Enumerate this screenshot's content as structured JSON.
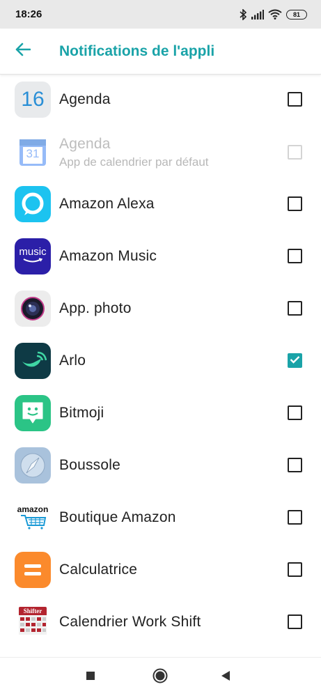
{
  "status_bar": {
    "time": "18:26",
    "battery": "81",
    "icons": [
      "bluetooth-icon",
      "signal-icon",
      "wifi-icon",
      "battery-icon"
    ]
  },
  "app_bar": {
    "title": "Notifications de l'appli",
    "back_icon": "arrow-left-icon"
  },
  "colors": {
    "accent": "#1aa3a8",
    "status_bar_bg": "#e9e9e9"
  },
  "apps": [
    {
      "name": "Agenda",
      "subtitle": "",
      "checked": false,
      "disabled": false,
      "icon_text": "16",
      "icon": "calendar-icon"
    },
    {
      "name": "Agenda",
      "subtitle": "App de calendrier par défaut",
      "checked": false,
      "disabled": true,
      "icon_text": "31",
      "icon": "google-calendar-icon"
    },
    {
      "name": "Amazon Alexa",
      "subtitle": "",
      "checked": false,
      "disabled": false,
      "icon": "alexa-icon"
    },
    {
      "name": "Amazon Music",
      "subtitle": "",
      "checked": false,
      "disabled": false,
      "icon_text": "music",
      "icon": "amazon-music-icon"
    },
    {
      "name": "App. photo",
      "subtitle": "",
      "checked": false,
      "disabled": false,
      "icon": "camera-icon"
    },
    {
      "name": "Arlo",
      "subtitle": "",
      "checked": true,
      "disabled": false,
      "icon": "arlo-icon"
    },
    {
      "name": "Bitmoji",
      "subtitle": "",
      "checked": false,
      "disabled": false,
      "icon": "bitmoji-icon"
    },
    {
      "name": "Boussole",
      "subtitle": "",
      "checked": false,
      "disabled": false,
      "icon": "compass-icon"
    },
    {
      "name": "Boutique Amazon",
      "subtitle": "",
      "checked": false,
      "disabled": false,
      "icon_text": "amazon",
      "icon": "amazon-shopping-icon"
    },
    {
      "name": "Calculatrice",
      "subtitle": "",
      "checked": false,
      "disabled": false,
      "icon": "calculator-icon"
    },
    {
      "name": "Calendrier Work Shift",
      "subtitle": "",
      "checked": false,
      "disabled": false,
      "icon_text": "Shifter",
      "icon": "shifter-calendar-icon"
    }
  ],
  "nav_bar": {
    "icons": [
      "recents-square-icon",
      "home-circle-icon",
      "back-triangle-icon"
    ]
  }
}
